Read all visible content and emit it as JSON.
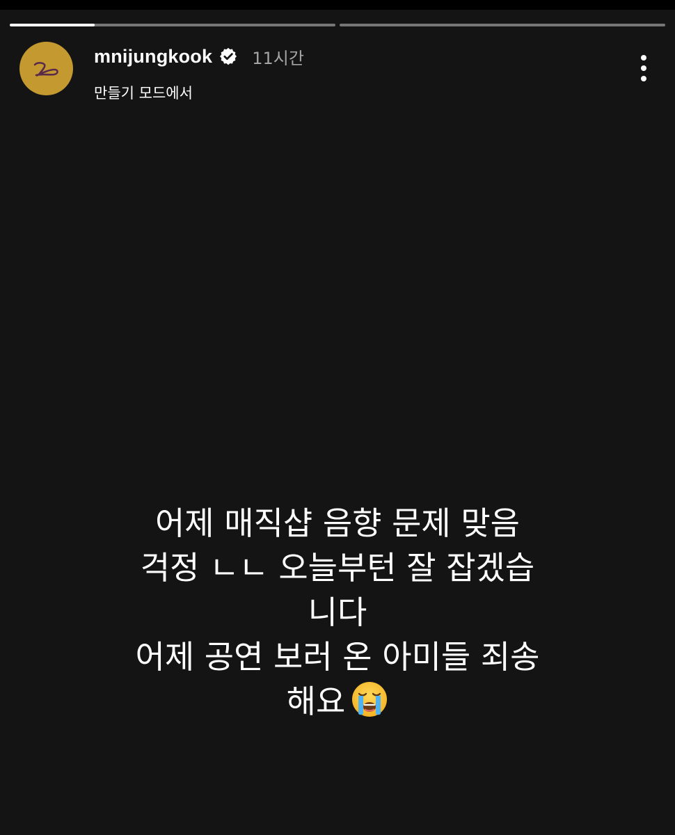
{
  "story": {
    "progress": [
      0.26,
      0
    ],
    "background_color": "#141414"
  },
  "header": {
    "avatar_icon": "gold-avatar-with-cursive-logo",
    "username": "mnijungkook",
    "verified_icon": "verified-badge-icon",
    "time_ago": "11시간",
    "subtitle": "만들기 모드에서",
    "more_icon": "more-vertical-icon"
  },
  "caption": {
    "lines": [
      "어제 매직샵 음향 문제 맞음",
      "걱정 ㄴㄴ 오늘부턴 잘 잡겠습",
      "니다",
      "어제 공연 보러 온 아미들 죄송",
      "해요"
    ],
    "emoji": "loudly-crying-face-emoji"
  },
  "colors": {
    "avatar_gold": "#c49a30",
    "time_gray": "#a5a5a5",
    "text_white": "#ffffff"
  }
}
